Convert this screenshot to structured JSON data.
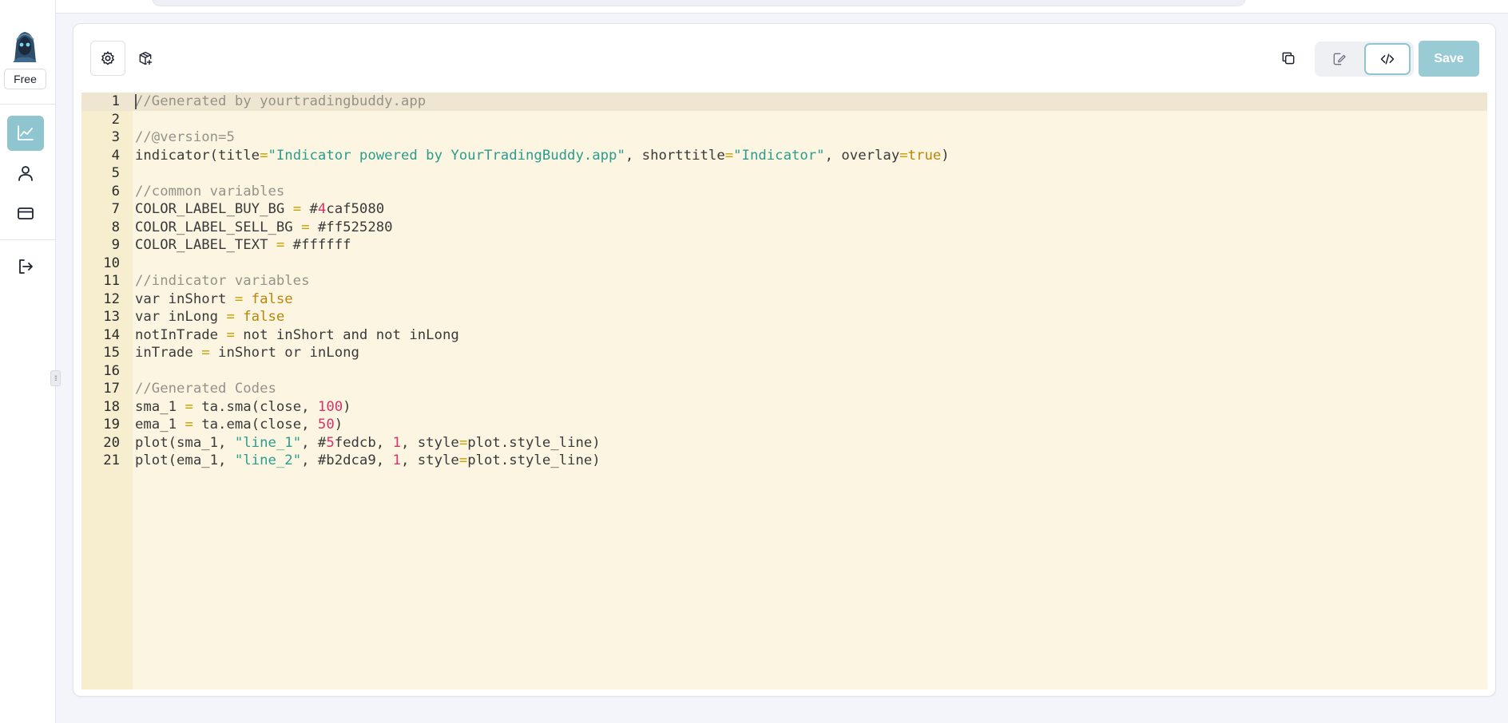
{
  "sidebar": {
    "plan_badge": "Free",
    "nav": [
      {
        "icon": "chart-line-icon",
        "active": true
      },
      {
        "icon": "user-icon",
        "active": false
      },
      {
        "icon": "credit-card-icon",
        "active": false
      },
      {
        "icon": "logout-icon",
        "active": false
      }
    ]
  },
  "toolbar": {
    "settings_icon": "gear-icon",
    "package_icon": "package-icon",
    "copy_icon": "copy-icon",
    "visual_mode_icon": "edit-icon",
    "code_mode_icon": "code-icon",
    "save_label": "Save"
  },
  "colors": {
    "accent": "#8fc5cf",
    "save_button": "#98cbd4",
    "editor_background": "#fcf5e2",
    "gutter_background": "#f6eecf"
  },
  "editor": {
    "active_line": 1,
    "lines": [
      {
        "number": "1",
        "tokens": [
          {
            "t": "c",
            "v": "//Generated by yourtradingbuddy.app"
          }
        ]
      },
      {
        "number": "2",
        "tokens": []
      },
      {
        "number": "3",
        "tokens": [
          {
            "t": "c",
            "v": "//@version=5"
          }
        ]
      },
      {
        "number": "4",
        "tokens": [
          {
            "t": "p",
            "v": "indicator(title"
          },
          {
            "t": "o",
            "v": "="
          },
          {
            "t": "s",
            "v": "\"Indicator powered by YourTradingBuddy.app\""
          },
          {
            "t": "p",
            "v": ", shorttitle"
          },
          {
            "t": "o",
            "v": "="
          },
          {
            "t": "s",
            "v": "\"Indicator\""
          },
          {
            "t": "p",
            "v": ", overlay"
          },
          {
            "t": "o",
            "v": "="
          },
          {
            "t": "k",
            "v": "true"
          },
          {
            "t": "p",
            "v": ")"
          }
        ]
      },
      {
        "number": "5",
        "tokens": []
      },
      {
        "number": "6",
        "tokens": [
          {
            "t": "c",
            "v": "//common variables"
          }
        ]
      },
      {
        "number": "7",
        "tokens": [
          {
            "t": "p",
            "v": "COLOR_LABEL_BUY_BG "
          },
          {
            "t": "o",
            "v": "="
          },
          {
            "t": "p",
            "v": " #"
          },
          {
            "t": "n",
            "v": "4"
          },
          {
            "t": "p",
            "v": "caf5080"
          }
        ]
      },
      {
        "number": "8",
        "tokens": [
          {
            "t": "p",
            "v": "COLOR_LABEL_SELL_BG "
          },
          {
            "t": "o",
            "v": "="
          },
          {
            "t": "p",
            "v": " #ff525280"
          }
        ]
      },
      {
        "number": "9",
        "tokens": [
          {
            "t": "p",
            "v": "COLOR_LABEL_TEXT "
          },
          {
            "t": "o",
            "v": "="
          },
          {
            "t": "p",
            "v": " #ffffff"
          }
        ]
      },
      {
        "number": "10",
        "tokens": []
      },
      {
        "number": "11",
        "tokens": [
          {
            "t": "c",
            "v": "//indicator variables"
          }
        ]
      },
      {
        "number": "12",
        "tokens": [
          {
            "t": "p",
            "v": "var inShort "
          },
          {
            "t": "o",
            "v": "="
          },
          {
            "t": "p",
            "v": " "
          },
          {
            "t": "k",
            "v": "false"
          }
        ]
      },
      {
        "number": "13",
        "tokens": [
          {
            "t": "p",
            "v": "var inLong "
          },
          {
            "t": "o",
            "v": "="
          },
          {
            "t": "p",
            "v": " "
          },
          {
            "t": "k",
            "v": "false"
          }
        ]
      },
      {
        "number": "14",
        "tokens": [
          {
            "t": "p",
            "v": "notInTrade "
          },
          {
            "t": "o",
            "v": "="
          },
          {
            "t": "p",
            "v": " not inShort and not inLong"
          }
        ]
      },
      {
        "number": "15",
        "tokens": [
          {
            "t": "p",
            "v": "inTrade "
          },
          {
            "t": "o",
            "v": "="
          },
          {
            "t": "p",
            "v": " inShort or inLong"
          }
        ]
      },
      {
        "number": "16",
        "tokens": []
      },
      {
        "number": "17",
        "tokens": [
          {
            "t": "c",
            "v": "//Generated Codes"
          }
        ]
      },
      {
        "number": "18",
        "tokens": [
          {
            "t": "p",
            "v": "sma_1 "
          },
          {
            "t": "o",
            "v": "="
          },
          {
            "t": "p",
            "v": " ta.sma(close, "
          },
          {
            "t": "n",
            "v": "100"
          },
          {
            "t": "p",
            "v": ")"
          }
        ]
      },
      {
        "number": "19",
        "tokens": [
          {
            "t": "p",
            "v": "ema_1 "
          },
          {
            "t": "o",
            "v": "="
          },
          {
            "t": "p",
            "v": " ta.ema(close, "
          },
          {
            "t": "n",
            "v": "50"
          },
          {
            "t": "p",
            "v": ")"
          }
        ]
      },
      {
        "number": "20",
        "tokens": [
          {
            "t": "p",
            "v": "plot(sma_1, "
          },
          {
            "t": "s",
            "v": "\"line_1\""
          },
          {
            "t": "p",
            "v": ", #"
          },
          {
            "t": "n",
            "v": "5"
          },
          {
            "t": "p",
            "v": "fedcb, "
          },
          {
            "t": "n",
            "v": "1"
          },
          {
            "t": "p",
            "v": ", style"
          },
          {
            "t": "o",
            "v": "="
          },
          {
            "t": "p",
            "v": "plot.style_line)"
          }
        ]
      },
      {
        "number": "21",
        "tokens": [
          {
            "t": "p",
            "v": "plot(ema_1, "
          },
          {
            "t": "s",
            "v": "\"line_2\""
          },
          {
            "t": "p",
            "v": ", #b2dca9, "
          },
          {
            "t": "n",
            "v": "1"
          },
          {
            "t": "p",
            "v": ", style"
          },
          {
            "t": "o",
            "v": "="
          },
          {
            "t": "p",
            "v": "plot.style_line)"
          }
        ]
      }
    ]
  }
}
